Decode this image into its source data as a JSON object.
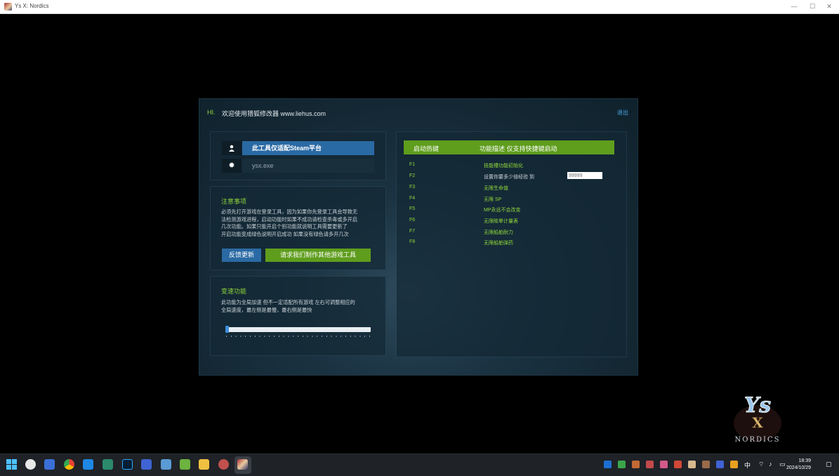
{
  "window": {
    "title": "Ys X: Nordics"
  },
  "panel": {
    "hi": "HI.",
    "welcome": "欢迎使用猎狐修改器 www.liehus.com",
    "exit": "退出"
  },
  "platform": {
    "user_icon": "user-icon",
    "label": "此工具仅适配Steam平台",
    "gear_icon": "gear-icon",
    "exe": "ysx.exe"
  },
  "notice": {
    "title": "注意事项",
    "lines": [
      "必须先打开游戏在登录工具，因为如果你先登录工具会导致无",
      "法检测游戏进程，启动功能时如果不成功请检查杀毒或多开启",
      "几次功能。如果只能开启个别功能就说明工具需要更新了",
      "开启功能变成绿色说明开启成功 如果没有绿色请多开几次"
    ],
    "feedback_button": "反馈更新",
    "request_button": "请求我们制作其他游戏工具"
  },
  "speed": {
    "title": "变速功能",
    "lines": [
      "此功能为全局加速 但不一定适配所有游戏 左右可调整相应的",
      "全局速度，最左侧是最慢，最右侧是最快"
    ],
    "slider_value": 0
  },
  "hotkeys": {
    "header_key": "启动热键",
    "header_desc": "功能描述 仅支持快捷键启动",
    "rows": [
      {
        "key": "F1",
        "desc": "技能槽功能初始化"
      },
      {
        "key": "F2",
        "desc": "设置你要多少倍经验 到",
        "input_placeholder": "99999"
      },
      {
        "key": "F3",
        "desc": "无限生命值"
      },
      {
        "key": "F4",
        "desc": "无限 SP"
      },
      {
        "key": "F5",
        "desc": "MP永远不会改变"
      },
      {
        "key": "F6",
        "desc": "无限眩晕计量表"
      },
      {
        "key": "F7",
        "desc": "无限船舶耐力"
      },
      {
        "key": "F8",
        "desc": "无限船舶弹药"
      }
    ]
  },
  "logo": {
    "line1": "Ys",
    "line2": "X",
    "line3": "NORDICS"
  },
  "taskbar": {
    "tray_ime": "中",
    "time": "18:39",
    "date": "2024/10/29"
  },
  "colors": {
    "accent_green": "#5f9d1d",
    "text_green": "#8fd63a",
    "accent_blue": "#2a6aa4",
    "panel_bg": "#142834"
  }
}
